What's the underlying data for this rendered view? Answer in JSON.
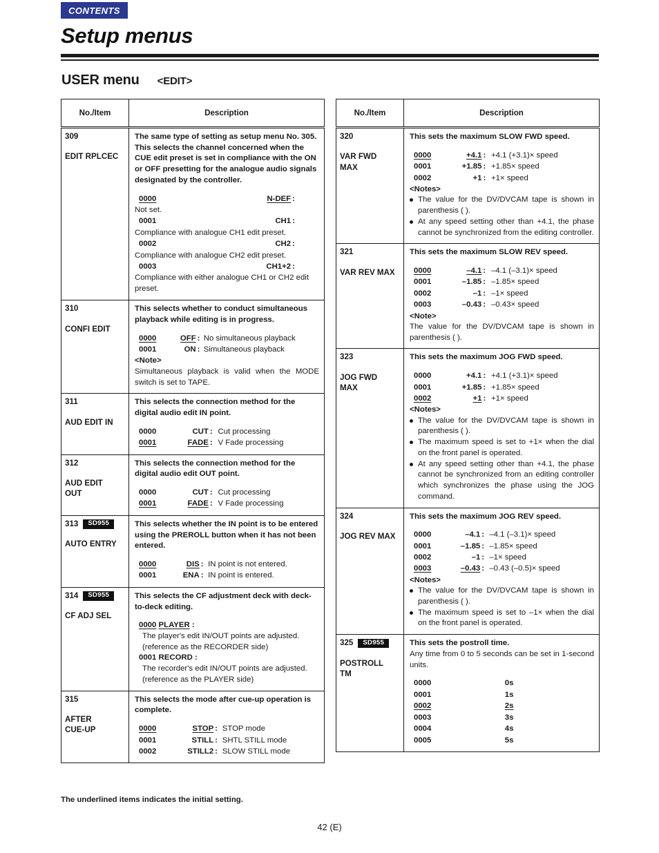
{
  "header": {
    "contents_tab": "CONTENTS",
    "doc_title": "Setup menus",
    "section_title": "USER menu",
    "section_subtitle": "<EDIT>"
  },
  "table_headers": {
    "no_item": "No./Item",
    "description": "Description"
  },
  "badge_label": "SD955",
  "left_table": {
    "rows": [
      {
        "no": "309",
        "badge": null,
        "item": "EDIT RPLCEC",
        "lead": "The same type of setting as setup menu No. 305. This selects the channel concerned when the CUE edit preset is set in compliance with the ON or OFF presetting for the analogue audio signals designated by the controller.",
        "options": [
          {
            "code": "0000",
            "value": "N-DEF",
            "underline": true,
            "meaning": "",
            "sub": "Not set."
          },
          {
            "code": "0001",
            "value": "CH1",
            "underline": false,
            "meaning": "",
            "sub": "Compliance with analogue CH1 edit preset."
          },
          {
            "code": "0002",
            "value": "CH2",
            "underline": false,
            "meaning": "",
            "sub": "Compliance with analogue CH2 edit preset."
          },
          {
            "code": "0003",
            "value": "CH1+2",
            "underline": false,
            "meaning": "",
            "sub": "Compliance with either analogue CH1 or CH2 edit preset."
          }
        ]
      },
      {
        "no": "310",
        "badge": null,
        "item": "CONFI EDIT",
        "lead": "This selects whether to conduct simultaneous playback while editing is in progress.",
        "options": [
          {
            "code": "0000",
            "value": "OFF",
            "underline": true,
            "meaning": "No simultaneous playback"
          },
          {
            "code": "0001",
            "value": "ON",
            "underline": false,
            "meaning": "Simultaneous playback"
          }
        ],
        "note_head": "<Note>",
        "note_text": "Simultaneous playback is valid when the MODE switch is set to TAPE."
      },
      {
        "no": "311",
        "badge": null,
        "item": "AUD EDIT IN",
        "lead": "This selects the connection method for the digital audio edit IN point.",
        "options": [
          {
            "code": "0000",
            "value": "CUT",
            "underline": false,
            "meaning": "Cut processing"
          },
          {
            "code": "0001",
            "value": "FADE",
            "underline": true,
            "meaning": "V Fade processing"
          }
        ]
      },
      {
        "no": "312",
        "badge": null,
        "item": "AUD EDIT\nOUT",
        "lead": "This selects the connection method for the digital audio edit OUT point.",
        "options": [
          {
            "code": "0000",
            "value": "CUT",
            "underline": false,
            "meaning": "Cut processing"
          },
          {
            "code": "0001",
            "value": "FADE",
            "underline": true,
            "meaning": "V Fade processing"
          }
        ]
      },
      {
        "no": "313",
        "badge": "SD955",
        "item": "AUTO ENTRY",
        "lead": "This selects whether the IN point is to be entered using the PREROLL button when it has not been entered.",
        "options": [
          {
            "code": "0000",
            "value": "DIS",
            "underline": true,
            "meaning": "IN point is not entered."
          },
          {
            "code": "0001",
            "value": "ENA",
            "underline": false,
            "meaning": "IN point is entered."
          }
        ]
      },
      {
        "no": "314",
        "badge": "SD955",
        "item": "CF ADJ SEL",
        "lead": "This selects the CF adjustment deck with deck-to-deck editing.",
        "inline_options": [
          {
            "code": "0000",
            "value": "PLAYER",
            "underline": true,
            "sub": "The player's edit IN/OUT points are adjusted. (reference as the RECORDER side)"
          },
          {
            "code": "0001",
            "value": "RECORD",
            "underline": false,
            "sub": "The recorder's edit IN/OUT points are adjusted. (reference as the PLAYER side)"
          }
        ]
      },
      {
        "no": "315",
        "badge": null,
        "item": "AFTER\nCUE-UP",
        "lead": "This selects the mode after cue-up operation is complete.",
        "options": [
          {
            "code": "0000",
            "value": "STOP",
            "underline": true,
            "meaning": "STOP mode"
          },
          {
            "code": "0001",
            "value": "STILL",
            "underline": false,
            "meaning": "SHTL STILL mode"
          },
          {
            "code": "0002",
            "value": "STILL2",
            "underline": false,
            "meaning": "SLOW STILL mode"
          }
        ]
      }
    ]
  },
  "right_table": {
    "rows": [
      {
        "no": "320",
        "badge": null,
        "item": "VAR FWD\nMAX",
        "lead": "This sets the maximum SLOW FWD speed.",
        "options": [
          {
            "code": "0000",
            "value": "+4.1",
            "underline": true,
            "meaning": "+4.1 (+3.1)× speed"
          },
          {
            "code": "0001",
            "value": "+1.85",
            "underline": false,
            "meaning": "+1.85× speed"
          },
          {
            "code": "0002",
            "value": "+1",
            "underline": false,
            "meaning": "+1× speed"
          }
        ],
        "note_head": "<Notes>",
        "bullets": [
          "The value for the DV/DVCAM tape is shown in parenthesis (   ).",
          "At any speed setting other than +4.1, the phase cannot be synchronized from the editing controller."
        ]
      },
      {
        "no": "321",
        "badge": null,
        "item": "VAR REV MAX",
        "lead": "This sets the maximum SLOW REV speed.",
        "options": [
          {
            "code": "0000",
            "value": "–4.1",
            "underline": true,
            "meaning": "–4.1 (–3.1)× speed"
          },
          {
            "code": "0001",
            "value": "–1.85",
            "underline": false,
            "meaning": "–1.85× speed"
          },
          {
            "code": "0002",
            "value": "–1",
            "underline": false,
            "meaning": "–1× speed"
          },
          {
            "code": "0003",
            "value": "–0.43",
            "underline": false,
            "meaning": "–0.43× speed"
          }
        ],
        "note_head": "<Note>",
        "note_text": "The value for the DV/DVCAM tape is shown in parenthesis (   )."
      },
      {
        "no": "323",
        "badge": null,
        "item": "JOG FWD\nMAX",
        "lead": "This sets the maximum JOG FWD speed.",
        "options": [
          {
            "code": "0000",
            "value": "+4.1",
            "underline": false,
            "meaning": "+4.1 (+3.1)× speed"
          },
          {
            "code": "0001",
            "value": "+1.85",
            "underline": false,
            "meaning": "+1.85× speed"
          },
          {
            "code": "0002",
            "value": "+1",
            "underline": true,
            "meaning": "+1× speed"
          }
        ],
        "note_head": "<Notes>",
        "bullets": [
          "The value for the DV/DVCAM tape is shown in parenthesis (   ).",
          "The maximum speed is set to +1× when the dial on the front panel is operated.",
          "At any speed setting other than +4.1, the phase cannot be synchronized from an editing controller which synchronizes the phase using the JOG command."
        ]
      },
      {
        "no": "324",
        "badge": null,
        "item": "JOG REV MAX",
        "lead": "This sets the maximum JOG REV speed.",
        "options": [
          {
            "code": "0000",
            "value": "–4.1",
            "underline": false,
            "meaning": "–4.1 (–3.1)× speed"
          },
          {
            "code": "0001",
            "value": "–1.85",
            "underline": false,
            "meaning": "–1.85× speed"
          },
          {
            "code": "0002",
            "value": "–1",
            "underline": false,
            "meaning": "–1× speed"
          },
          {
            "code": "0003",
            "value": "–0.43",
            "underline": true,
            "meaning": "–0.43 (–0.5)× speed"
          }
        ],
        "note_head": "<Notes>",
        "bullets": [
          "The value for the DV/DVCAM tape is shown in parenthesis (   ).",
          "The maximum speed is set to –1× when the dial on the front panel is operated."
        ]
      },
      {
        "no": "325",
        "badge": "SD955",
        "item": "POSTROLL\nTM",
        "lead": "This sets the postroll time.",
        "lead_plain": "Any time from 0 to 5 seconds can be set in 1-second units.",
        "simple_options": [
          {
            "code": "0000",
            "value": "0s",
            "underline": false
          },
          {
            "code": "0001",
            "value": "1s",
            "underline": false
          },
          {
            "code": "0002",
            "value": "2s",
            "underline": true
          },
          {
            "code": "0003",
            "value": "3s",
            "underline": false
          },
          {
            "code": "0004",
            "value": "4s",
            "underline": false
          },
          {
            "code": "0005",
            "value": "5s",
            "underline": false
          }
        ]
      }
    ]
  },
  "footer": {
    "footnote": "The underlined items indicates the initial setting.",
    "page_number": "42 (E)"
  },
  "colors": {
    "tab_blue": "#2b3990",
    "badge_black": "#111111",
    "ink": "#1a1a1a"
  }
}
